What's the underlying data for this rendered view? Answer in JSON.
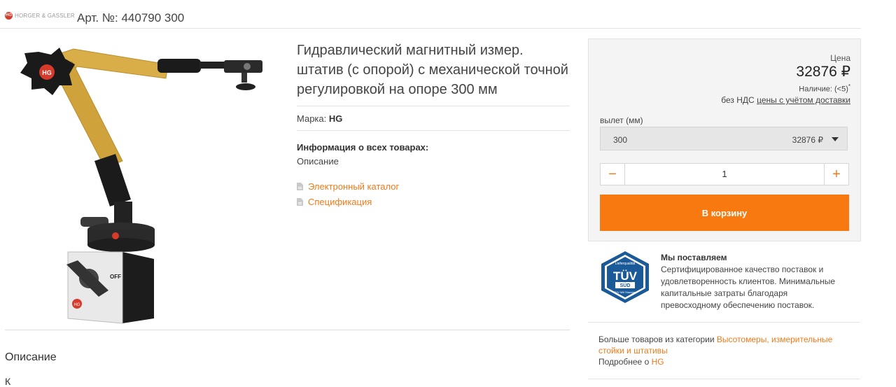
{
  "header": {
    "logo_mark": "HG",
    "logo_text": "HORGER & GASSLER",
    "article": "Арт. №: 440790 300"
  },
  "product": {
    "title": "Гидравлический магнитный измер. штатив (с опорой) с механической точной регулировкой на опоре 300 мм",
    "brand_label": "Марка:",
    "brand_value": "HG",
    "info_title": "Информация о всех товарах:",
    "info_desc": "Описание",
    "docs": [
      "Электронный каталог",
      "Спецификация"
    ],
    "image_labels": {
      "knob": "HG",
      "off": "OFF",
      "base": "HG"
    }
  },
  "purchase": {
    "price_label": "Цена",
    "price": "32876 ₽",
    "stock_label": "Наличие: (<5)",
    "stock_mark": "*",
    "vat_text": "без НДС",
    "vat_link": "цены с учётом доставки",
    "option_label": "вылет (мм)",
    "option_value": "300",
    "option_price": "32876 ₽",
    "qty_minus": "−",
    "qty_value": "1",
    "qty_plus": "+",
    "cart_button": "В корзину"
  },
  "delivery": {
    "badge_top": "Lieferqualität",
    "badge_main": "TÜV",
    "badge_sub": "SÜD",
    "badge_bottom": "TÜV Mill Standard",
    "title": "Мы поставляем",
    "text": "Сертифицированное качество поставок и удовлетворенность клиентов. Минимальные капитальные затраты благодаря превосходному обеспечению поставок."
  },
  "more": {
    "category_prefix": "Больше товаров из категории",
    "category_link": "Высотомеры, измерительные стойки и штативы",
    "brand_prefix": "Подробнее о",
    "brand_link": "HG"
  },
  "description": {
    "heading": "Описание",
    "cut_text": "К"
  },
  "colors": {
    "accent": "#f7790f",
    "link": "#f07a1a",
    "gold_arm": "#d4a83e",
    "tuv_blue": "#1a5a99"
  }
}
